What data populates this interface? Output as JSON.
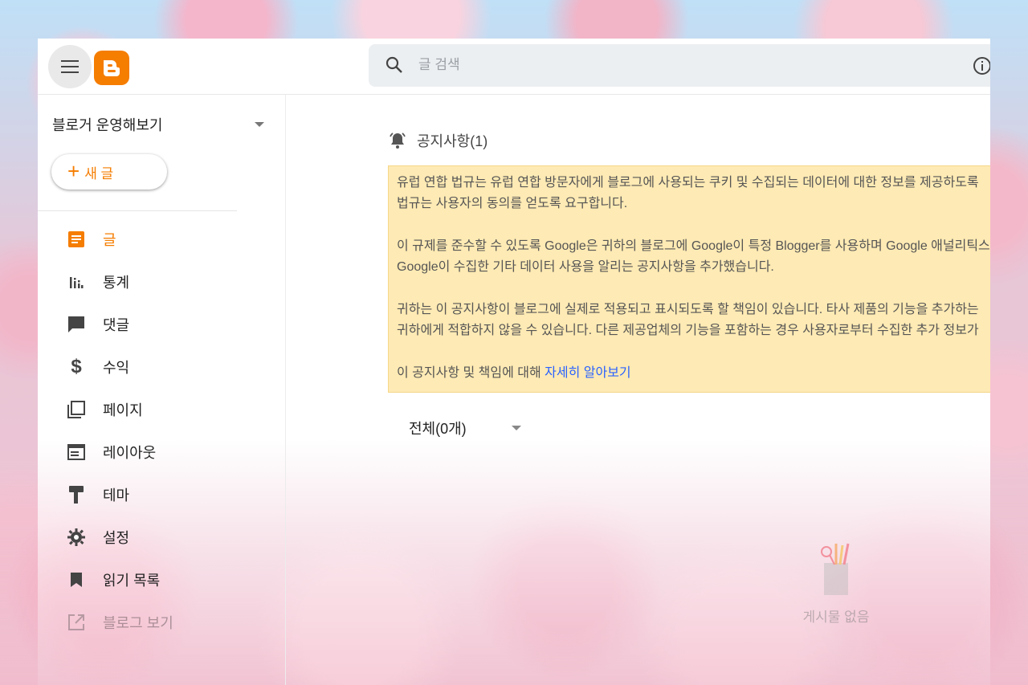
{
  "topbar": {
    "search_placeholder": "글 검색"
  },
  "sidebar": {
    "blog_name": "블로거 운영해보기",
    "new_post_label": "새 글",
    "items": [
      {
        "label": "글",
        "icon": "posts-icon"
      },
      {
        "label": "통계",
        "icon": "stats-icon"
      },
      {
        "label": "댓글",
        "icon": "comments-icon"
      },
      {
        "label": "수익",
        "icon": "dollar-icon"
      },
      {
        "label": "페이지",
        "icon": "pages-icon"
      },
      {
        "label": "레이아웃",
        "icon": "layout-icon"
      },
      {
        "label": "테마",
        "icon": "paint-roller-icon"
      },
      {
        "label": "설정",
        "icon": "gear-icon"
      },
      {
        "label": "읽기 목록",
        "icon": "bookmark-icon"
      },
      {
        "label": "블로그 보기",
        "icon": "open-external-icon"
      }
    ]
  },
  "main": {
    "notice_title": "공지사항(1)",
    "notice": {
      "p1_line1": "유럽 연합 법규는 유럽 연합 방문자에게 블로그에 사용되는 쿠키 및 수집되는 데이터에 대한 정보를 제공하도록",
      "p1_line2": "법규는 사용자의 동의를 얻도록 요구합니다.",
      "p2_line1": "이 규제를 준수할 수 있도록 Google은 귀하의 블로그에 Google이 특정 Blogger를 사용하며 Google 애널리틱스",
      "p2_line2": "Google이 수집한 기타 데이터 사용을 알리는 공지사항을 추가했습니다.",
      "p3_line1": "귀하는 이 공지사항이 블로그에 실제로 적용되고 표시되도록 할 책임이 있습니다. 타사 제품의 기능을 추가하는",
      "p3_line2": "귀하에게 적합하지 않을 수 있습니다. 다른 제공업체의 기능을 포함하는 경우 사용자로부터 수집한 추가 정보가",
      "p4_text": "이 공지사항 및 책임에 대해 ",
      "p4_link": "자세히 알아보기"
    },
    "filter_label": "전체(0개)",
    "empty_label": "게시물 없음"
  },
  "colors": {
    "brand": "#f57d00",
    "notice_bg": "#feeab4",
    "link": "#2962ff"
  }
}
